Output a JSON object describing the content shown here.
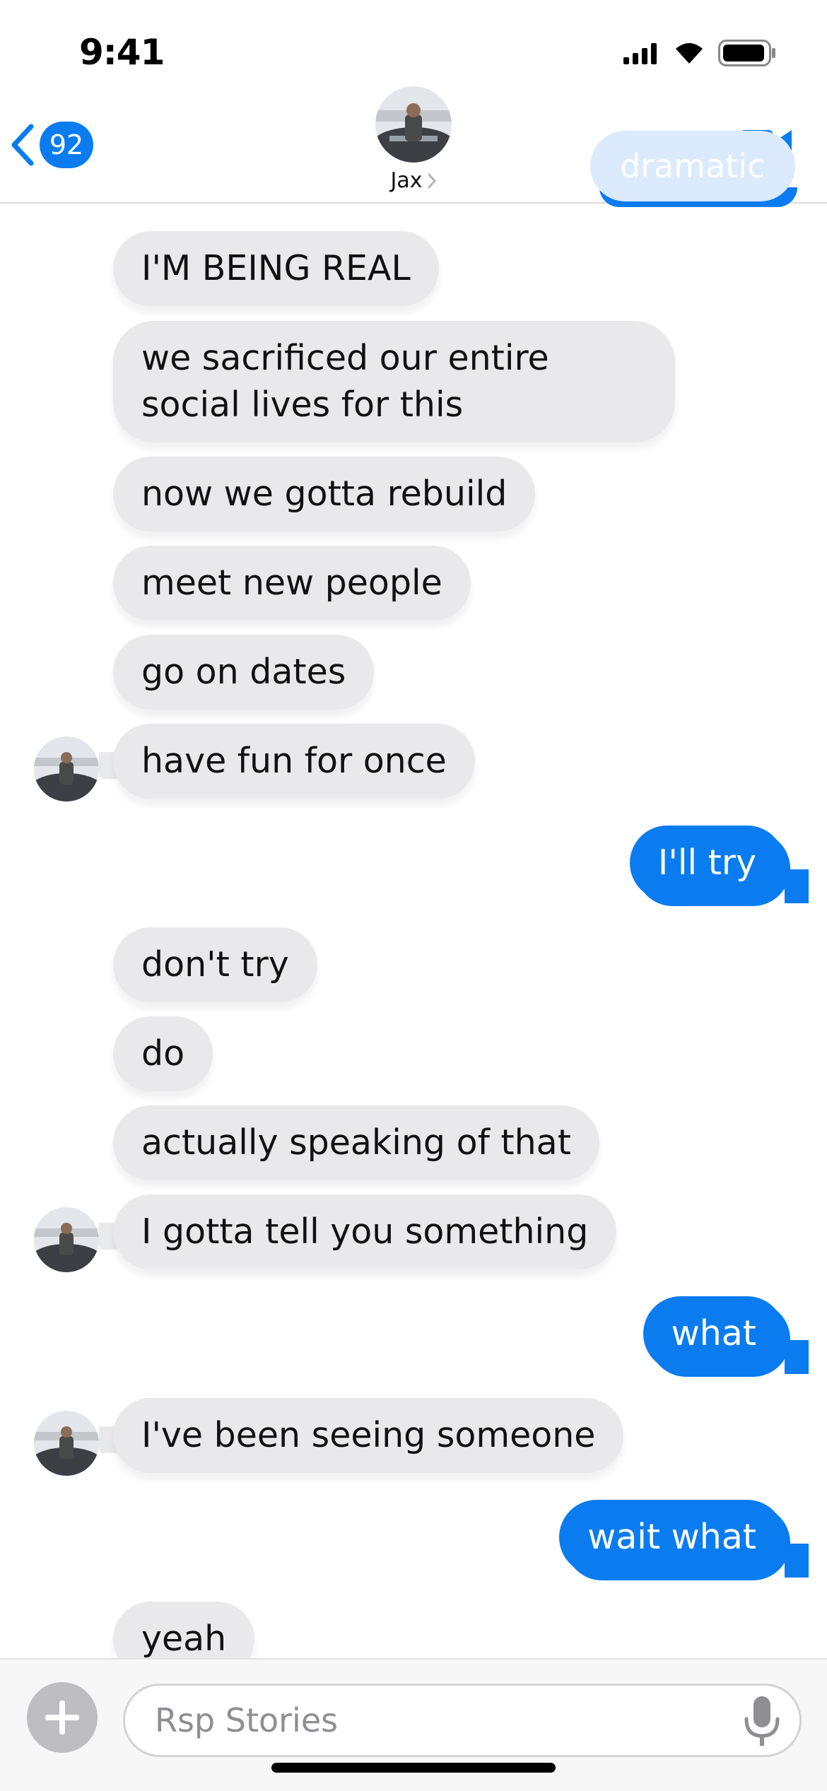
{
  "status": {
    "time": "9:41"
  },
  "header": {
    "back_count": "92",
    "contact_name": "Jax",
    "previous_message_partial": "dramatic"
  },
  "messages": [
    {
      "from": "contact",
      "text": "I'M BEING REAL"
    },
    {
      "from": "contact",
      "text": "we sacrificed our entire social lives for this"
    },
    {
      "from": "contact",
      "text": "now we gotta rebuild"
    },
    {
      "from": "contact",
      "text": "meet new people"
    },
    {
      "from": "contact",
      "text": "go on dates"
    },
    {
      "from": "contact",
      "text": "have fun for once"
    },
    {
      "from": "me",
      "text": "I'll try"
    },
    {
      "from": "contact",
      "text": "don't try"
    },
    {
      "from": "contact",
      "text": "do"
    },
    {
      "from": "contact",
      "text": "actually speaking of that"
    },
    {
      "from": "contact",
      "text": "I gotta tell you something"
    },
    {
      "from": "me",
      "text": "what"
    },
    {
      "from": "contact",
      "text": "I've been seeing someone"
    },
    {
      "from": "me",
      "text": "wait what"
    },
    {
      "from": "contact",
      "text": "yeah"
    }
  ],
  "composer": {
    "placeholder": "Rsp Stories"
  },
  "colors": {
    "accent": "#0a7cf0",
    "incoming_bubble": "#e9e9eb",
    "outgoing_text": "#ffffff",
    "placeholder": "#8e8e93"
  },
  "icons": [
    "signal-icon",
    "wifi-icon",
    "battery-icon",
    "back-chevron-icon",
    "chevron-right-icon",
    "video-camera-icon",
    "plus-icon",
    "microphone-icon"
  ]
}
